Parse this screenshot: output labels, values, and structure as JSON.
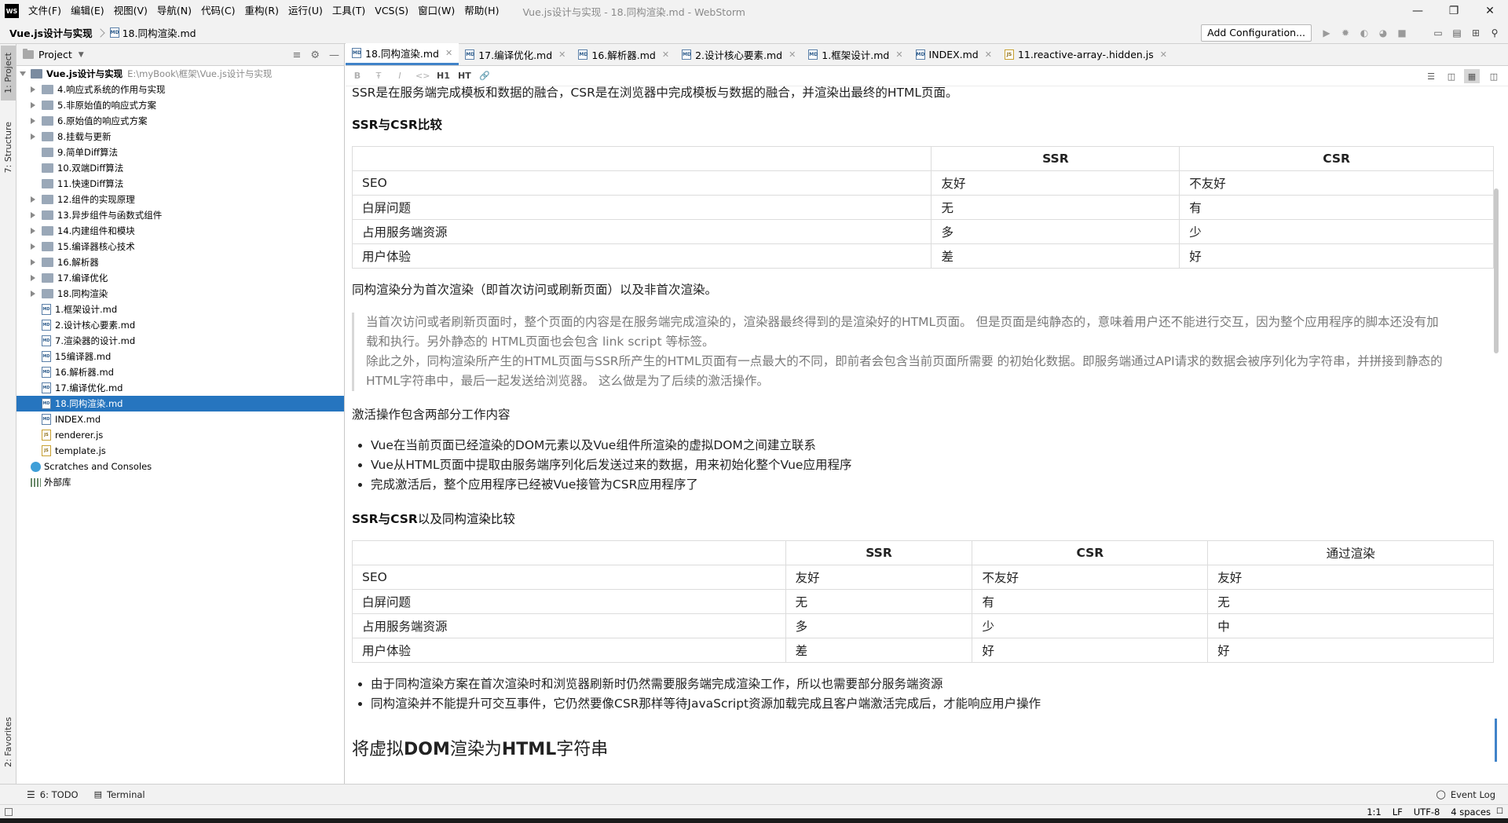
{
  "app": {
    "logo_text": "WS",
    "window_title": "Vue.js设计与实现 - 18.同构渲染.md - WebStorm",
    "menu": [
      "文件(F)",
      "编辑(E)",
      "视图(V)",
      "导航(N)",
      "代码(C)",
      "重构(R)",
      "运行(U)",
      "工具(T)",
      "VCS(S)",
      "窗口(W)",
      "帮助(H)"
    ]
  },
  "navbar": {
    "root": "Vue.js设计与实现",
    "file": "18.同构渲染.md",
    "add_configuration": "Add Configuration..."
  },
  "left_strip": {
    "project_tab": "1: Project",
    "structure_tab": "7: Structure",
    "favorites_tab": "2: Favorites"
  },
  "project_panel": {
    "title": "Project",
    "root_name": "Vue.js设计与实现",
    "root_path": "E:\\myBook\\框架\\Vue.js设计与实现",
    "folders": [
      "4.响应式系统的作用与实现",
      "5.非原始值的响应式方案",
      "6.原始值的响应式方案",
      "8.挂载与更新",
      "9.简单Diff算法",
      "10.双端Diff算法",
      "11.快速Diff算法",
      "12.组件的实现原理",
      "13.异步组件与函数式组件",
      "14.内建组件和模块",
      "15.编译器核心技术",
      "16.解析器",
      "17.编译优化",
      "18.同构渲染"
    ],
    "files": [
      "1.框架设计.md",
      "2.设计核心要素.md",
      "7.渲染器的设计.md",
      "15编译器.md",
      "16.解析器.md",
      "17.编译优化.md",
      "18.同构渲染.md",
      "INDEX.md",
      "renderer.js",
      "template.js"
    ],
    "scratches": "Scratches and Consoles",
    "external_libs": "外部库"
  },
  "editor_tabs": [
    {
      "label": "18.同构渲染.md",
      "type": "md"
    },
    {
      "label": "17.编译优化.md",
      "type": "md"
    },
    {
      "label": "16.解析器.md",
      "type": "md"
    },
    {
      "label": "2.设计核心要素.md",
      "type": "md"
    },
    {
      "label": "1.框架设计.md",
      "type": "md"
    },
    {
      "label": "INDEX.md",
      "type": "md"
    },
    {
      "label": "11.reactive-array-.hidden.js",
      "type": "js"
    }
  ],
  "editor_toolbar": [
    "B",
    "Ŧ",
    "I",
    "<>",
    "H1",
    "HT",
    "🔗"
  ],
  "doc": {
    "intro": "SSR是在服务端完成模板和数据的融合，CSR是在浏览器中完成模板与数据的融合，并渲染出最终的HTML页面。",
    "compare1_title": "SSR与CSR比较",
    "table1": {
      "headers": [
        "",
        "SSR",
        "CSR"
      ],
      "rows": [
        [
          "SEO",
          "友好",
          "不友好"
        ],
        [
          "白屏问题",
          "无",
          "有"
        ],
        [
          "占用服务端资源",
          "多",
          "少"
        ],
        [
          "用户体验",
          "差",
          "好"
        ]
      ]
    },
    "iso_para": "同构渲染分为首次渲染（即首次访问或刷新页面）以及非首次渲染。",
    "quote": [
      "当首次访问或者刷新页面时，整个页面的内容是在服务端完成渲染的，渲染器最终得到的是渲染好的HTML页面。 但是页面是纯静态的，意味着用户还不能进行交互，因为整个应用程序的脚本还没有加",
      "载和执行。另外静态的 HTML页面也会包含 link script 等标签。",
      "除此之外，同构渲染所产生的HTML页面与SSR所产生的HTML页面有一点最大的不同，即前者会包含当前页面所需要 的初始化数据。即服务端通过API请求的数据会被序列化为字符串，并拼接到静态的",
      "HTML字符串中，最后一起发送给浏览器。 这么做是为了后续的激活操作。"
    ],
    "hydrate_para": "激活操作包含两部分工作内容",
    "hydrate_list": [
      "Vue在当前页面已经渲染的DOM元素以及Vue组件所渲染的虚拟DOM之间建立联系",
      "Vue从HTML页面中提取由服务端序列化后发送过来的数据，用来初始化整个Vue应用程序",
      "完成激活后，整个应用程序已经被Vue接管为CSR应用程序了"
    ],
    "compare2_title_bold": "SSR与CSR",
    "compare2_title_rest": "以及同构渲染比较",
    "table2": {
      "headers": [
        "",
        "SSR",
        "CSR",
        "通过渲染"
      ],
      "rows": [
        [
          "SEO",
          "友好",
          "不友好",
          "友好"
        ],
        [
          "白屏问题",
          "无",
          "有",
          "无"
        ],
        [
          "占用服务端资源",
          "多",
          "少",
          "中"
        ],
        [
          "用户体验",
          "差",
          "好",
          "好"
        ]
      ]
    },
    "notes": [
      "由于同构渲染方案在首次渲染时和浏览器刷新时仍然需要服务端完成渲染工作，所以也需要部分服务端资源",
      "同构渲染并不能提升可交互事件，它仍然要像CSR那样等待JavaScript资源加载完成且客户端激活完成后，才能响应用户操作"
    ],
    "h2_pre": "将虚拟",
    "h2_bold1": "DOM",
    "h2_mid": "渲染为",
    "h2_bold2": "HTML",
    "h2_post": "字符串"
  },
  "bottom_bar": {
    "todo": "6: TODO",
    "terminal": "Terminal",
    "event_log": "Event Log"
  },
  "status": {
    "position": "1:1",
    "line_sep": "LF",
    "encoding": "UTF-8",
    "indent": "4 spaces"
  },
  "colors": {
    "accent": "#2675bf",
    "tab_underline": "#4083c9"
  }
}
